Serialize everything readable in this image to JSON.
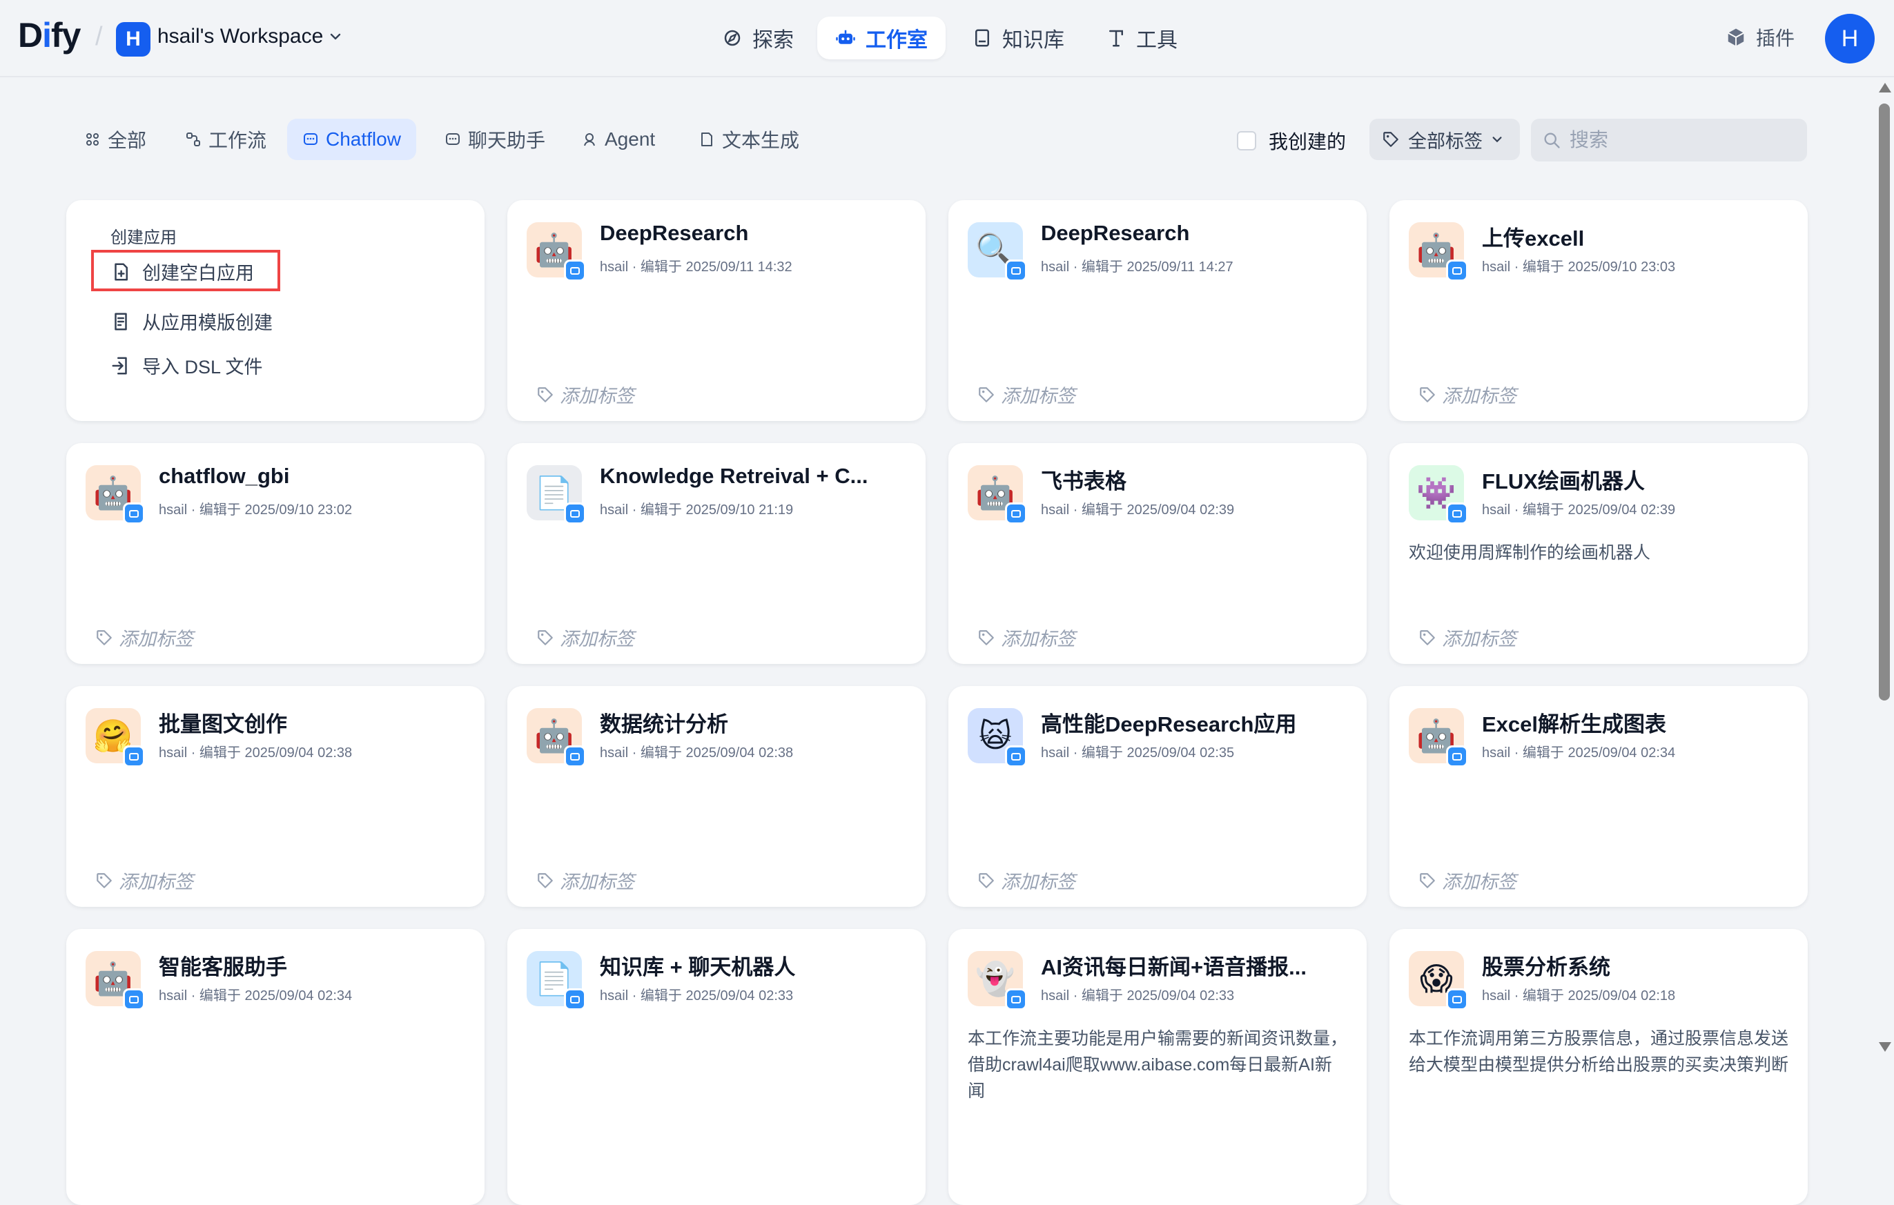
{
  "brand": {
    "logo_a": "D",
    "logo_b": "i",
    "logo_c": "fy"
  },
  "workspace": {
    "badge": "H",
    "name": "hsail's Workspace"
  },
  "nav": {
    "explore": "探索",
    "studio": "工作室",
    "knowledge": "知识库",
    "tools": "工具"
  },
  "header": {
    "plugins": "插件",
    "avatar": "H"
  },
  "filters": {
    "tabs": [
      "全部",
      "工作流",
      "Chatflow",
      "聊天助手",
      "Agent",
      "文本生成"
    ],
    "active_tab": "Chatflow",
    "created_by_me": "我创建的",
    "all_tags": "全部标签",
    "search_placeholder": "搜索"
  },
  "create": {
    "heading": "创建应用",
    "blank": "创建空白应用",
    "from_template": "从应用模版创建",
    "import_dsl": "导入 DSL 文件"
  },
  "add_tag_label": "添加标签",
  "apps": [
    {
      "title": "DeepResearch",
      "meta": "hsail · 编辑于 2025/09/11 14:32",
      "icon": "robot-icon",
      "icon_bg": "#fde7d6",
      "desc": ""
    },
    {
      "title": "DeepResearch",
      "meta": "hsail · 编辑于 2025/09/11 14:27",
      "icon": "magnifier-icon",
      "icon_bg": "#d1e9ff",
      "desc": ""
    },
    {
      "title": "上传excell",
      "meta": "hsail · 编辑于 2025/09/10 23:03",
      "icon": "robot-icon",
      "icon_bg": "#fde7d6",
      "desc": ""
    },
    {
      "title": "chatflow_gbi",
      "meta": "hsail · 编辑于 2025/09/10 23:02",
      "icon": "robot-icon",
      "icon_bg": "#fde7d6",
      "desc": ""
    },
    {
      "title": "Knowledge Retreival + C...",
      "meta": "hsail · 编辑于 2025/09/10 21:19",
      "icon": "document-icon",
      "icon_bg": "#eaecf0",
      "desc": ""
    },
    {
      "title": "飞书表格",
      "meta": "hsail · 编辑于 2025/09/04 02:39",
      "icon": "robot-icon",
      "icon_bg": "#fde7d6",
      "desc": ""
    },
    {
      "title": "FLUX绘画机器人",
      "meta": "hsail · 编辑于 2025/09/04 02:39",
      "icon": "alien-icon",
      "icon_bg": "#dcfae6",
      "desc": "欢迎使用周辉制作的绘画机器人"
    },
    {
      "title": "批量图文创作",
      "meta": "hsail · 编辑于 2025/09/04 02:38",
      "icon": "hugging-face-icon",
      "icon_bg": "#fde7d6",
      "desc": ""
    },
    {
      "title": "数据统计分析",
      "meta": "hsail · 编辑于 2025/09/04 02:38",
      "icon": "robot-icon",
      "icon_bg": "#fde7d6",
      "desc": ""
    },
    {
      "title": "高性能DeepResearch应用",
      "meta": "hsail · 编辑于 2025/09/04 02:35",
      "icon": "cat-face-icon",
      "icon_bg": "#d1e0ff",
      "desc": ""
    },
    {
      "title": "Excel解析生成图表",
      "meta": "hsail · 编辑于 2025/09/04 02:34",
      "icon": "robot-icon",
      "icon_bg": "#fde7d6",
      "desc": ""
    },
    {
      "title": "智能客服助手",
      "meta": "hsail · 编辑于 2025/09/04 02:34",
      "icon": "robot-icon",
      "icon_bg": "#fde7d6",
      "desc": ""
    },
    {
      "title": "知识库 + 聊天机器人",
      "meta": "hsail · 编辑于 2025/09/04 02:33",
      "icon": "document-icon",
      "icon_bg": "#d1e9ff",
      "desc": ""
    },
    {
      "title": "AI资讯每日新闻+语音播报...",
      "meta": "hsail · 编辑于 2025/09/04 02:33",
      "icon": "ghost-icon",
      "icon_bg": "#fde7d6",
      "desc": "本工作流主要功能是用户输需要的新闻资讯数量，借助crawl4ai爬取www.aibase.com每日最新AI新闻"
    },
    {
      "title": "股票分析系统",
      "meta": "hsail · 编辑于 2025/09/04 02:18",
      "icon": "scream-face-icon",
      "icon_bg": "#fde7d6",
      "desc": "本工作流调用第三方股票信息，通过股票信息发送给大模型由模型提供分析给出股票的买卖决策判断"
    }
  ],
  "colors": {
    "accent": "#155eef",
    "badge": "#2e90fa",
    "highlight": "#ef4444"
  }
}
